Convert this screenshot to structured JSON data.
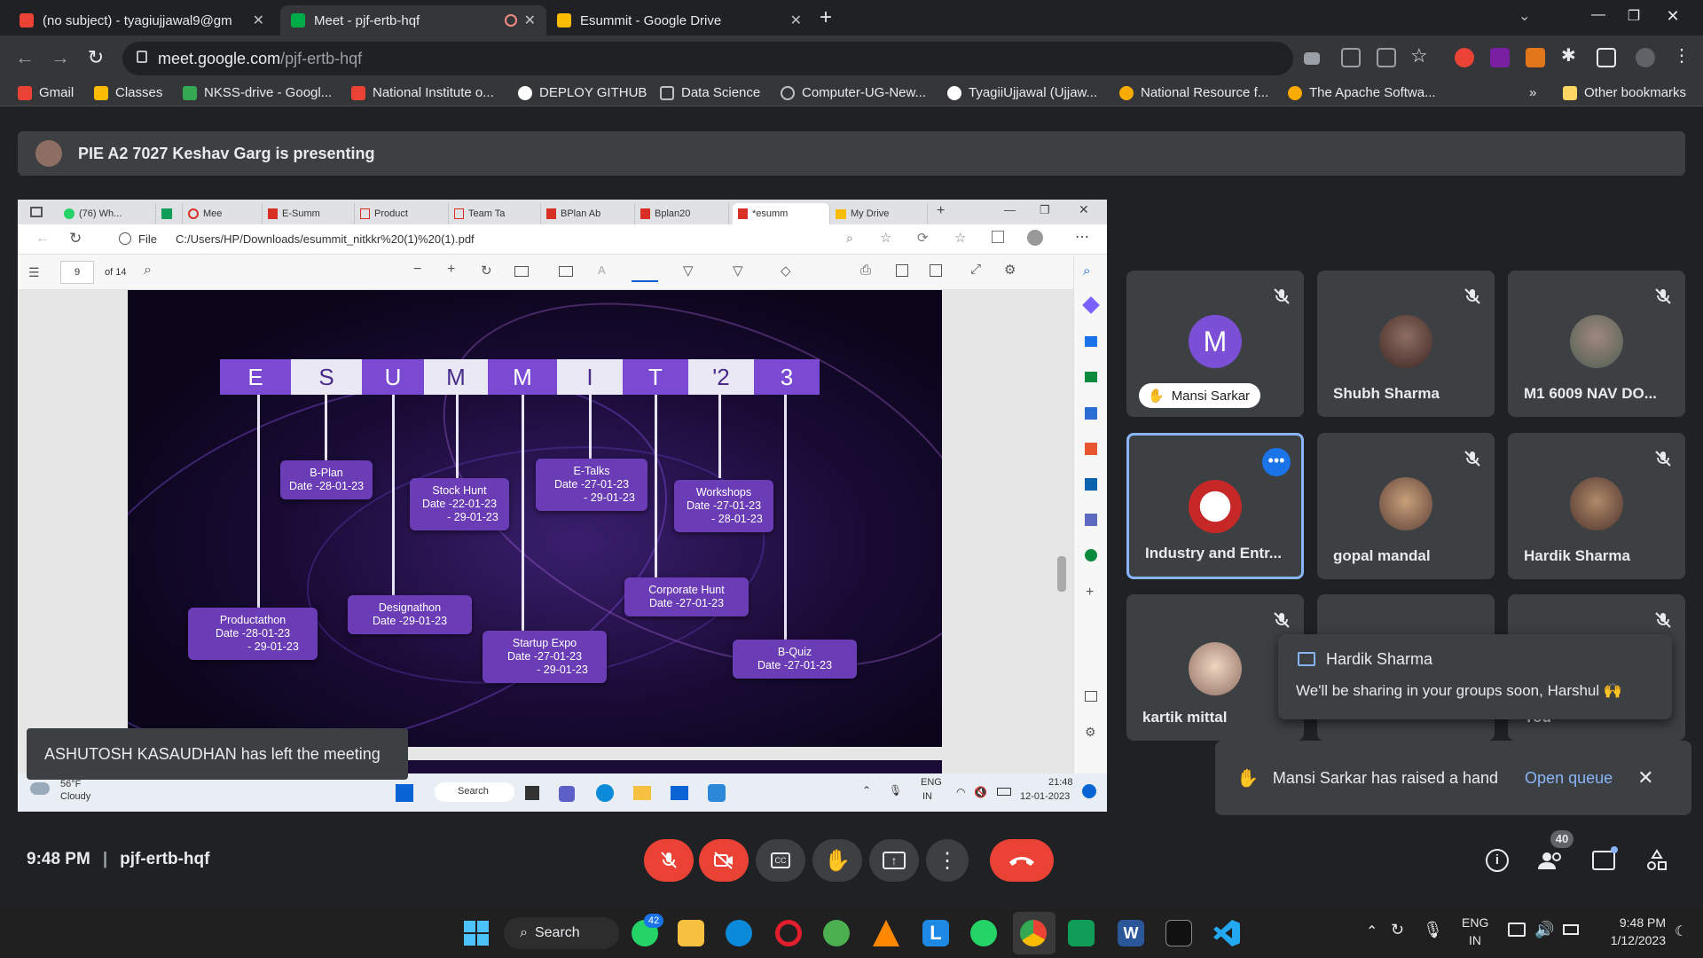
{
  "browser": {
    "tabs": [
      {
        "label": "(no subject) - tyagiujjawal9@gm",
        "icon": "gmail-icon",
        "color": "#ea4335"
      },
      {
        "label": "Meet - pjf-ertb-hqf",
        "icon": "meet-icon",
        "color": "#00ac47",
        "active": true
      },
      {
        "label": "Esummit - Google Drive",
        "icon": "drive-icon",
        "color": "#fbbc04"
      }
    ],
    "new_tab": "+",
    "url_host": "meet.google.com",
    "url_path": "/pjf-ertb-hqf",
    "bookmarks": [
      {
        "label": "Gmail",
        "icon": "gmail-icon",
        "color": "#ea4335"
      },
      {
        "label": "Classes",
        "icon": "classroom-icon",
        "color": "#fbbc04"
      },
      {
        "label": "NKSS-drive - Googl...",
        "icon": "drive-icon",
        "color": "#34a853"
      },
      {
        "label": "National Institute o...",
        "icon": "gmail-icon",
        "color": "#ea4335"
      },
      {
        "label": "DEPLOY GITHUB",
        "icon": "github-icon",
        "color": "#ffffff"
      },
      {
        "label": "Data Science",
        "icon": "page-icon",
        "color": "#bdc1c6"
      },
      {
        "label": "Computer-UG-New...",
        "icon": "globe-icon",
        "color": "#bdc1c6"
      },
      {
        "label": "TyagiiUjjawal (Ujjaw...",
        "icon": "github-icon",
        "color": "#ffffff"
      },
      {
        "label": "National Resource f...",
        "icon": "feather-icon",
        "color": "#f9ab00"
      },
      {
        "label": "The Apache Softwa...",
        "icon": "feather-icon",
        "color": "#f9ab00"
      }
    ],
    "more_bookmarks": "»",
    "other_bookmarks": "Other bookmarks"
  },
  "meet": {
    "presenting": "PIE A2 7027 Keshav Garg is presenting",
    "meeting_time": "9:48 PM",
    "meeting_code": "pjf-ertb-hqf",
    "participants_count": "40",
    "toast": "ASHUTOSH KASAUDHAN has left the meeting",
    "tiles": [
      {
        "name": "Mansi Sarkar",
        "initial": "M",
        "avatar_color": "#7b4fd6",
        "hand_raised": true
      },
      {
        "name": "Shubh Sharma",
        "avatar_color": "#5d4a3a"
      },
      {
        "name": "M1 6009 NAV DO...",
        "avatar_color": "#6b7a70"
      },
      {
        "name": "Industry and Entr...",
        "avatar_color": "#c62828",
        "highlighted": true
      },
      {
        "name": "gopal mandal",
        "avatar_color": "#9e7b5b"
      },
      {
        "name": "Hardik Sharma",
        "avatar_color": "#7a5a3e"
      },
      {
        "name": "kartik mittal",
        "avatar_color": "#c9a98c"
      },
      {
        "name": "",
        "avatar_color": "#3c4043"
      },
      {
        "name": "You",
        "avatar_color": "#3c4043"
      }
    ],
    "chat_popup": {
      "sender": "Hardik Sharma",
      "message": "We'll be sharing in your groups soon, Harshul 🙌"
    },
    "hand_popup": {
      "text": "Mansi Sarkar has raised a hand",
      "action": "Open queue"
    }
  },
  "shared": {
    "edge_tabs": [
      "(76) Wh...",
      "",
      "Mee",
      "E-Summ",
      "Product",
      "Team Ta",
      "BPlan Ab",
      "Bplan20",
      "*esumm",
      "My Drive"
    ],
    "file_label": "File",
    "file_path": "C:/Users/HP/Downloads/esummit_nitkkr%20(1)%20(1).pdf",
    "page_current": "9",
    "page_total": "of 14",
    "slide_letters": [
      "E",
      "S",
      "U",
      "M",
      "M",
      "I",
      "T",
      "'2",
      "3"
    ],
    "events": [
      {
        "title": "B-Plan",
        "date": "Date -28-01-23"
      },
      {
        "title": "Stock Hunt",
        "date": "Date -22-01-23",
        "date2": "- 29-01-23"
      },
      {
        "title": "E-Talks",
        "date": "Date -27-01-23",
        "date2": "- 29-01-23"
      },
      {
        "title": "Workshops",
        "date": "Date -27-01-23",
        "date2": "- 28-01-23"
      },
      {
        "title": "Productathon",
        "date": "Date -28-01-23",
        "date2": "- 29-01-23"
      },
      {
        "title": "Designathon",
        "date": "Date -29-01-23"
      },
      {
        "title": "Startup Expo",
        "date": "Date -27-01-23",
        "date2": "- 29-01-23"
      },
      {
        "title": "Corporate Hunt",
        "date": "Date -27-01-23"
      },
      {
        "title": "B-Quiz",
        "date": "Date -27-01-23"
      }
    ],
    "weather_temp": "56°F",
    "weather_desc": "Cloudy",
    "search": "Search",
    "lang1": "ENG",
    "lang2": "IN",
    "clock_time": "21:48",
    "clock_date": "12-01-2023"
  },
  "windows": {
    "search": "Search",
    "whatsapp_badge": "42",
    "lang1": "ENG",
    "lang2": "IN",
    "time": "9:48 PM",
    "date": "1/12/2023"
  }
}
